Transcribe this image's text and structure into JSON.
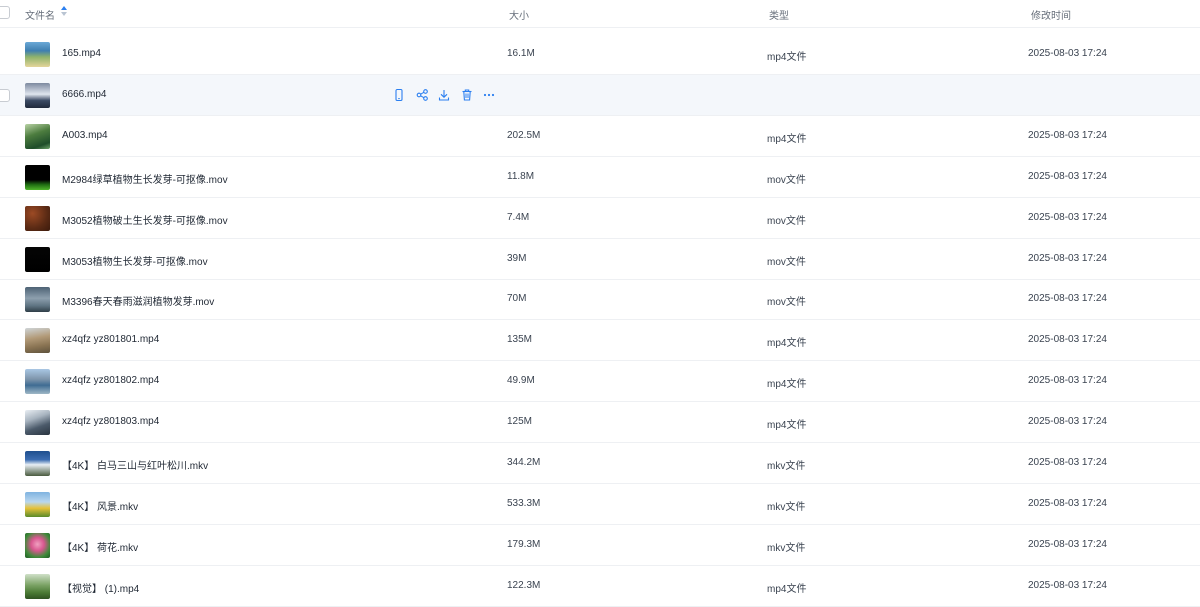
{
  "header": {
    "name": "文件名",
    "size": "大小",
    "type": "类型",
    "modified": "修改时间"
  },
  "rows": [
    {
      "name": "165.mp4",
      "size": "16.1M",
      "type": "mp4文件",
      "modified": "2025-08-03 17:24",
      "thumb": "ocean-landscape"
    },
    {
      "name": "6666.mp4",
      "size": "",
      "type": "",
      "modified": "",
      "thumb": "people-scene",
      "hover": true
    },
    {
      "name": "A003.mp4",
      "size": "202.5M",
      "type": "mp4文件",
      "modified": "2025-08-03 17:24",
      "thumb": "forest"
    },
    {
      "name": "M2984绿草植物生长发芽-可抠像.mov",
      "size": "11.8M",
      "type": "mov文件",
      "modified": "2025-08-03 17:24",
      "thumb": "grass-on-black"
    },
    {
      "name": "M3052植物破土生长发芽-可抠像.mov",
      "size": "7.4M",
      "type": "mov文件",
      "modified": "2025-08-03 17:24",
      "thumb": "soil"
    },
    {
      "name": "M3053植物生长发芽-可抠像.mov",
      "size": "39M",
      "type": "mov文件",
      "modified": "2025-08-03 17:24",
      "thumb": "black"
    },
    {
      "name": "M3396春天春雨滋润植物发芽.mov",
      "size": "70M",
      "type": "mov文件",
      "modified": "2025-08-03 17:24",
      "thumb": "rain-sky"
    },
    {
      "name": "xz4qfz yz801801.mp4",
      "size": "135M",
      "type": "mp4文件",
      "modified": "2025-08-03 17:24",
      "thumb": "rocky-hill"
    },
    {
      "name": "xz4qfz yz801802.mp4",
      "size": "49.9M",
      "type": "mp4文件",
      "modified": "2025-08-03 17:24",
      "thumb": "lake-mountain"
    },
    {
      "name": "xz4qfz yz801803.mp4",
      "size": "125M",
      "type": "mp4文件",
      "modified": "2025-08-03 17:24",
      "thumb": "snow-peak"
    },
    {
      "name": "【4K】 白马三山与红叶松川.mkv",
      "size": "344.2M",
      "type": "mkv文件",
      "modified": "2025-08-03 17:24",
      "thumb": "snow-mountain-blue"
    },
    {
      "name": "【4K】 风景.mkv",
      "size": "533.3M",
      "type": "mkv文件",
      "modified": "2025-08-03 17:24",
      "thumb": "flower-field"
    },
    {
      "name": "【4K】 荷花.mkv",
      "size": "179.3M",
      "type": "mkv文件",
      "modified": "2025-08-03 17:24",
      "thumb": "lotus"
    },
    {
      "name": "【视觉】 (1).mp4",
      "size": "122.3M",
      "type": "mp4文件",
      "modified": "2025-08-03 17:24",
      "thumb": "meadow"
    }
  ],
  "row_actions": [
    "phone-icon",
    "share-icon",
    "download-icon",
    "delete-icon",
    "more-icon"
  ],
  "colors": {
    "accent": "#2b7ff0",
    "hover_row": "#f4f7fb",
    "divider": "#eef0f3"
  }
}
